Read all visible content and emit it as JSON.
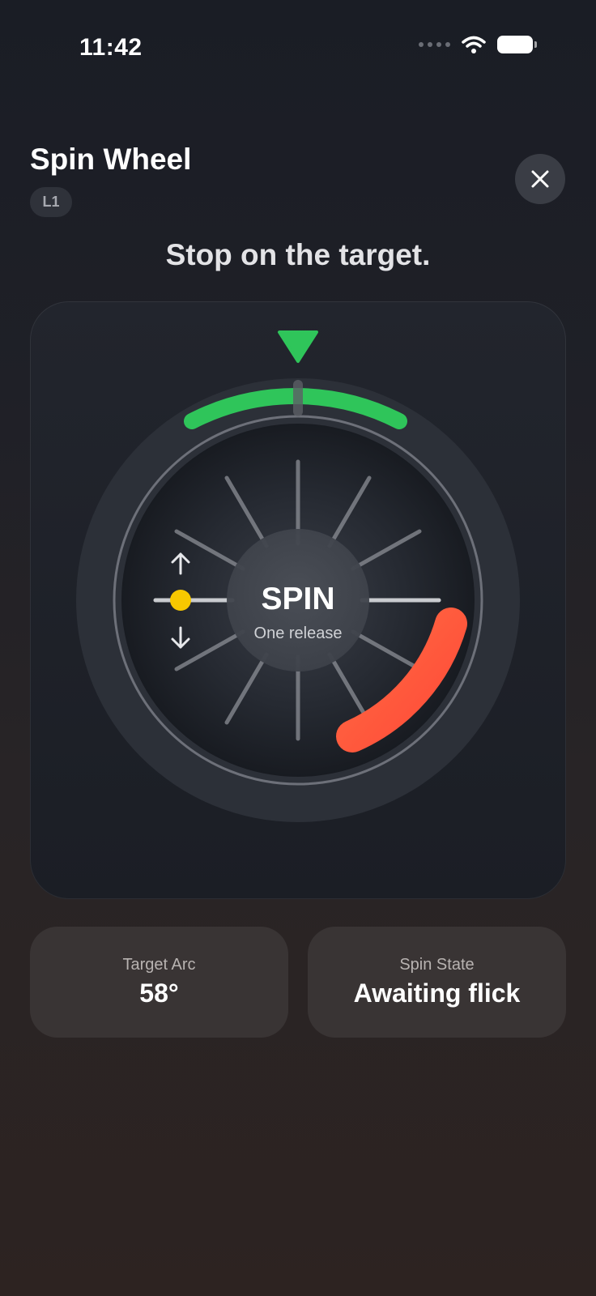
{
  "status_bar": {
    "time": "11:42"
  },
  "header": {
    "title": "Spin Wheel",
    "level": "L1"
  },
  "instruction": "Stop on the target.",
  "wheel": {
    "center_label": "SPIN",
    "center_sublabel": "One release",
    "target_color": "#2fc55a",
    "pointer_color": "#2fc55a",
    "danger_color": "#ff5a3c",
    "handle_color": "#f7c800",
    "target_arc_degrees": 58
  },
  "stats": [
    {
      "label": "Target Arc",
      "value": "58°"
    },
    {
      "label": "Spin State",
      "value": "Awaiting flick"
    }
  ]
}
